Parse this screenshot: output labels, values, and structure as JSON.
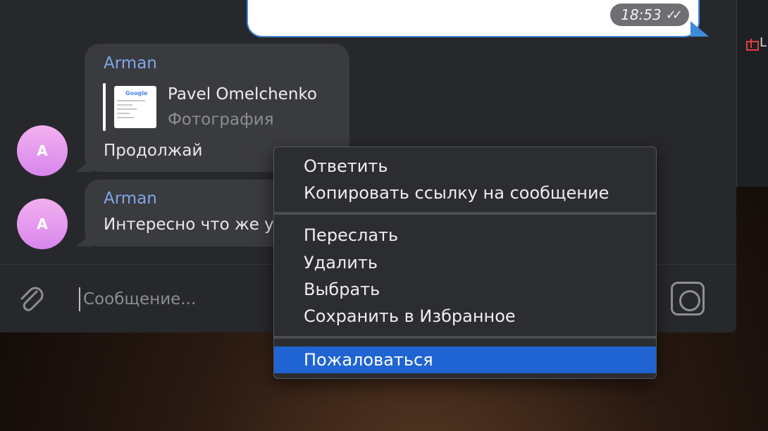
{
  "right_panel": {
    "label": "L"
  },
  "outgoing": {
    "time": "18:53"
  },
  "messages": [
    {
      "sender": "Arman",
      "avatar_letter": "A",
      "forward": {
        "name": "Pavel Omelchenko",
        "type": "Фотография",
        "thumb_text": "Google"
      },
      "text": "Продолжай"
    },
    {
      "sender": "Arman",
      "avatar_letter": "A",
      "text": "Интересно что же у"
    }
  ],
  "input": {
    "placeholder": "Сообщение..."
  },
  "context_menu": {
    "items": [
      "Ответить",
      "Копировать ссылку на сообщение",
      "Переслать",
      "Удалить",
      "Выбрать",
      "Сохранить в Избранное",
      "Пожаловаться"
    ],
    "highlighted": "Пожаловаться"
  },
  "colors": {
    "accent": "#1f64d2",
    "sender": "#7fa6e8",
    "avatar": "#d886ec"
  },
  "icons": {
    "attach": "paperclip-icon",
    "camera": "camera-icon",
    "read": "double-check-icon",
    "gift": "gift-icon"
  }
}
